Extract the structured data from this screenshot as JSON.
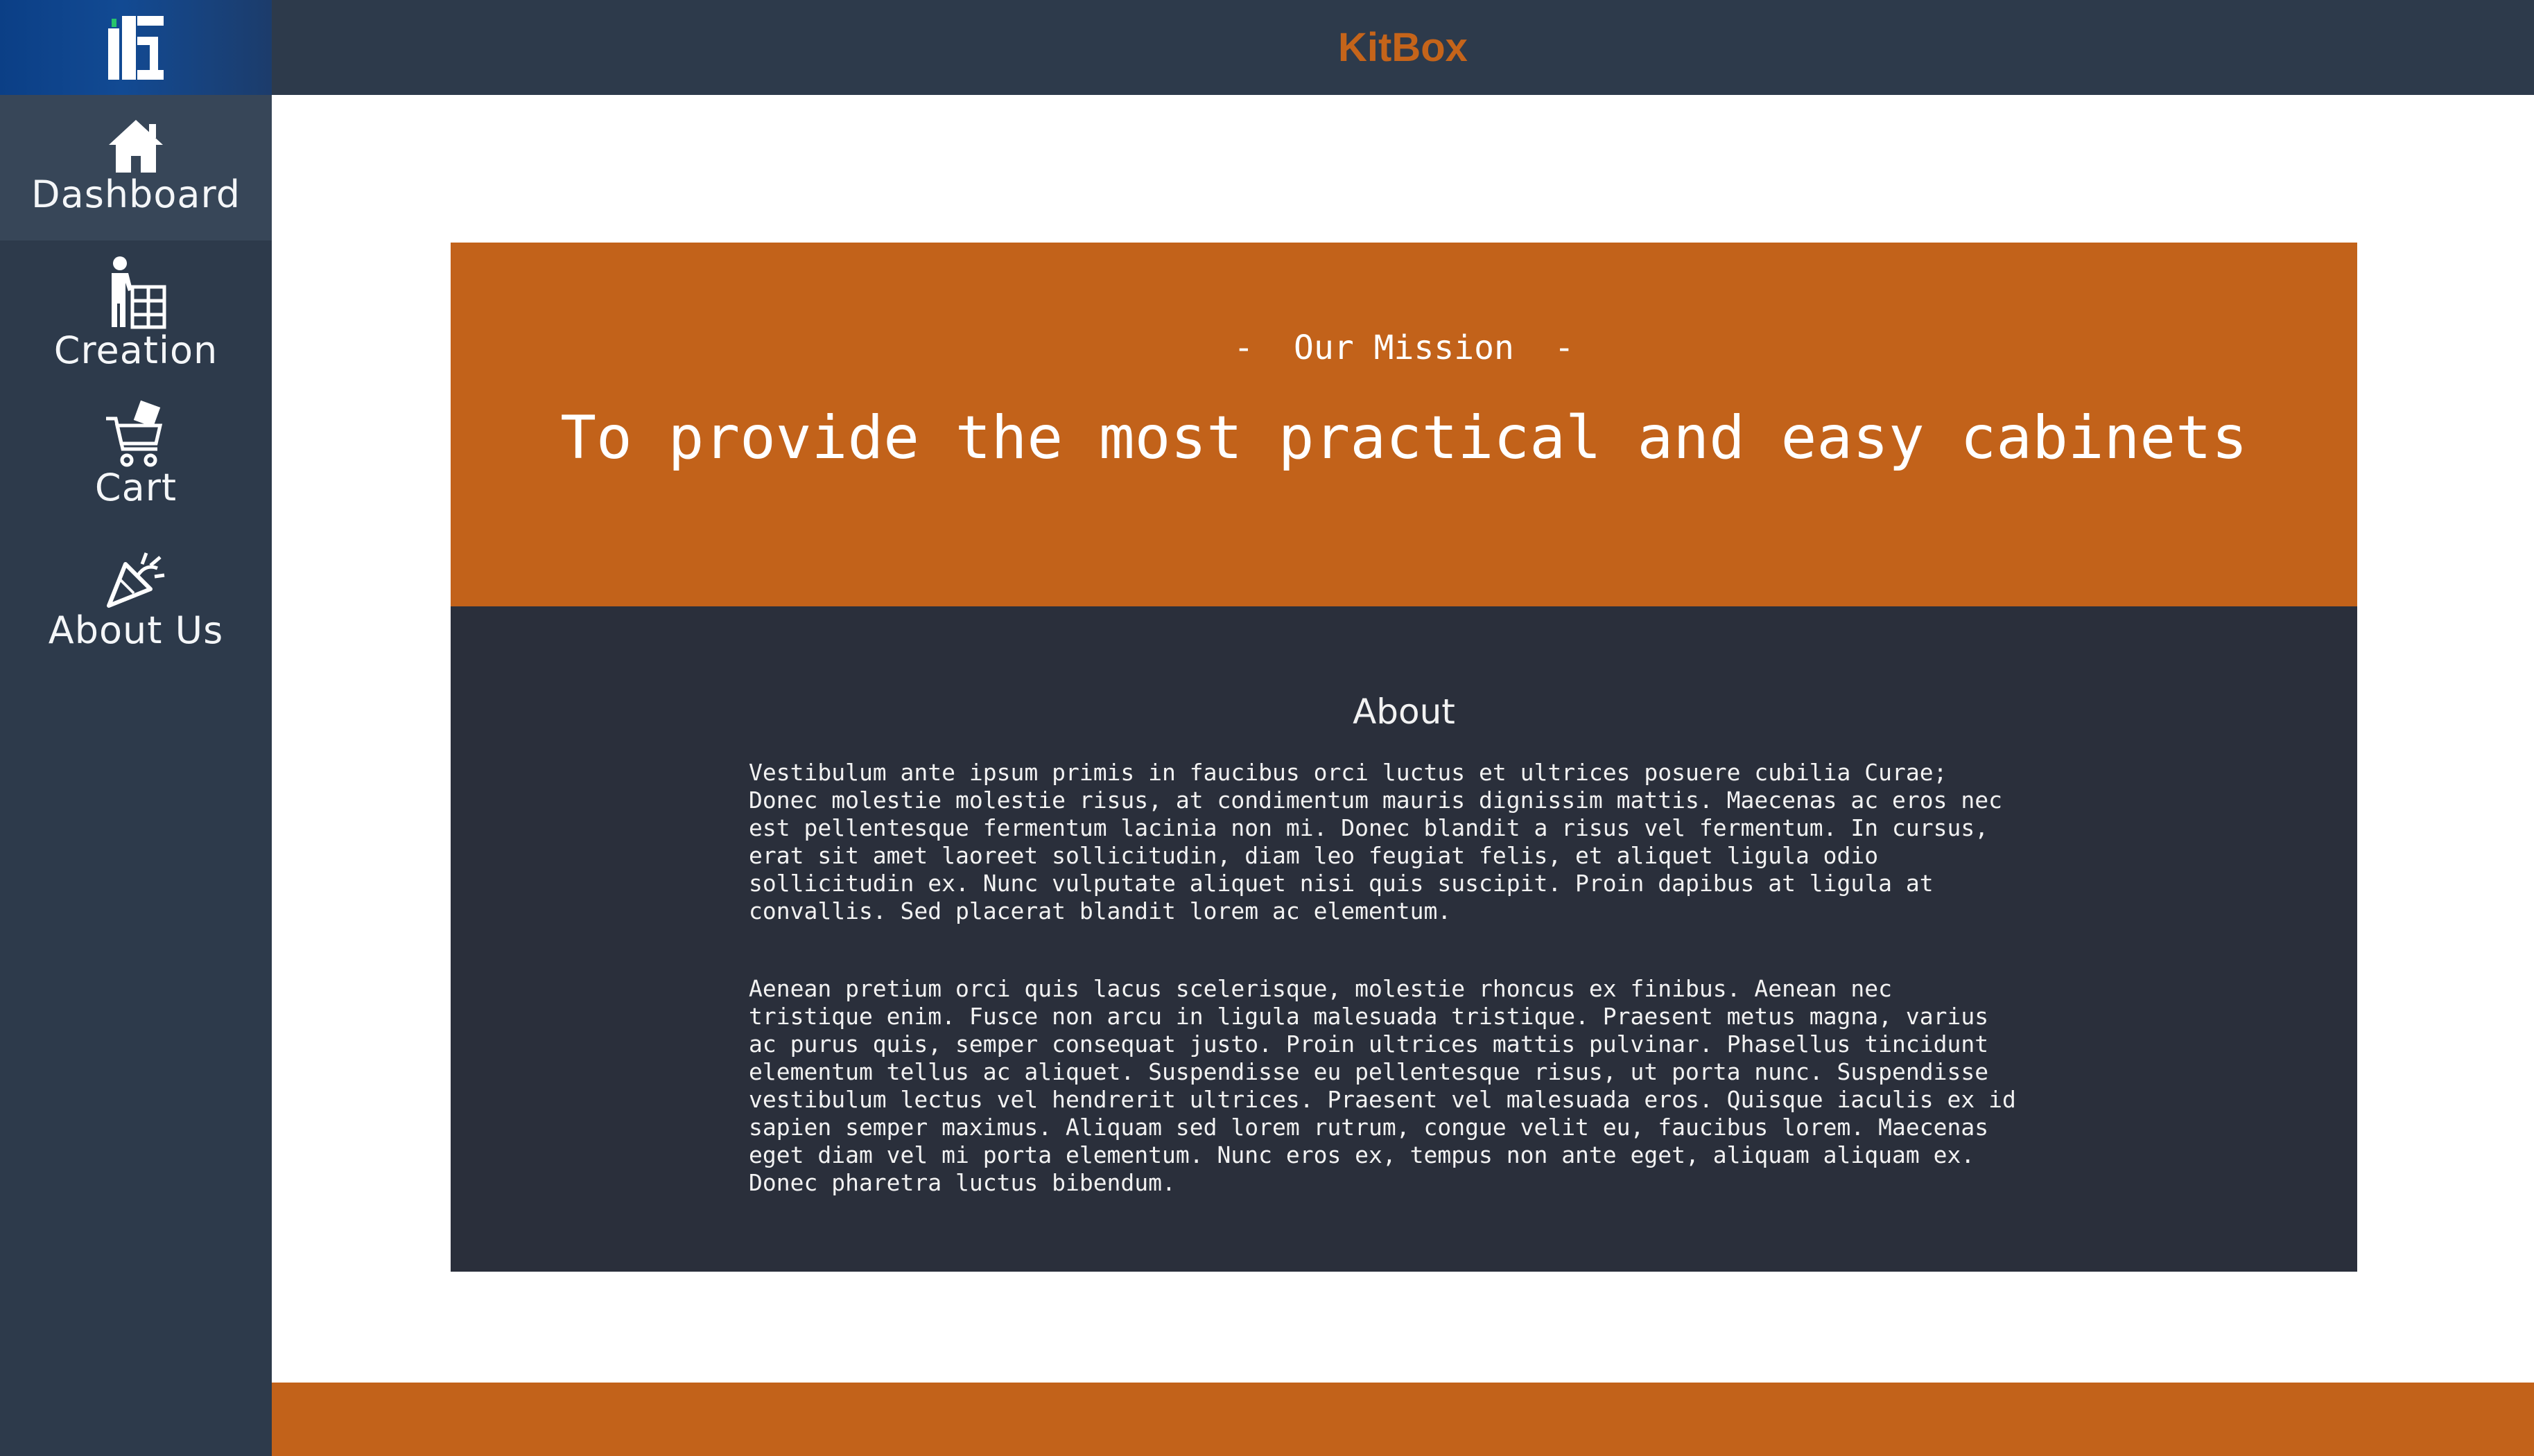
{
  "header": {
    "brand": "KitBox"
  },
  "sidebar": {
    "logo_icon": "kitbox-logo-icon",
    "items": [
      {
        "label": "Dashboard",
        "icon": "home-icon",
        "active": true
      },
      {
        "label": "Creation",
        "icon": "builder-icon"
      },
      {
        "label": "Cart",
        "icon": "cart-icon"
      },
      {
        "label": "About Us",
        "icon": "party-popper-icon"
      }
    ]
  },
  "mission": {
    "subtitle": "-  Our Mission  -",
    "headline": "To provide the most practical and easy cabinets"
  },
  "about": {
    "title": "About",
    "paragraphs": [
      "Vestibulum ante ipsum primis in faucibus orci luctus et ultrices posuere cubilia Curae;\nDonec molestie molestie risus, at condimentum mauris dignissim mattis. Maecenas ac eros nec\nest pellentesque fermentum lacinia non mi. Donec blandit a risus vel fermentum. In cursus,\nerat sit amet laoreet sollicitudin, diam leo feugiat felis, et aliquet ligula odio\nsollicitudin ex. Nunc vulputate aliquet nisi quis suscipit. Proin dapibus at ligula at\nconvallis. Sed placerat blandit lorem ac elementum.",
      "Aenean pretium orci quis lacus scelerisque, molestie rhoncus ex finibus. Aenean nec\ntristique enim. Fusce non arcu in ligula malesuada tristique. Praesent metus magna, varius\nac purus quis, semper consequat justo. Proin ultrices mattis pulvinar. Phasellus tincidunt\nelementum tellus ac aliquet. Suspendisse eu pellentesque risus, ut porta nunc. Suspendisse\nvestibulum lectus vel hendrerit ultrices. Praesent vel malesuada eros. Quisque iaculis ex id\nsapien semper maximus. Aliquam sed lorem rutrum, congue velit eu, faucibus lorem. Maecenas\neget diam vel mi porta elementum. Nunc eros ex, tempus non ante eget, aliquam aliquam ex.\nDonec pharetra luctus bibendum."
    ]
  },
  "colors": {
    "sidebar": "#2d3a4b",
    "accent_orange": "#c2621a",
    "brand_orange": "#c5641a",
    "about_panel": "#2a2f3b"
  }
}
